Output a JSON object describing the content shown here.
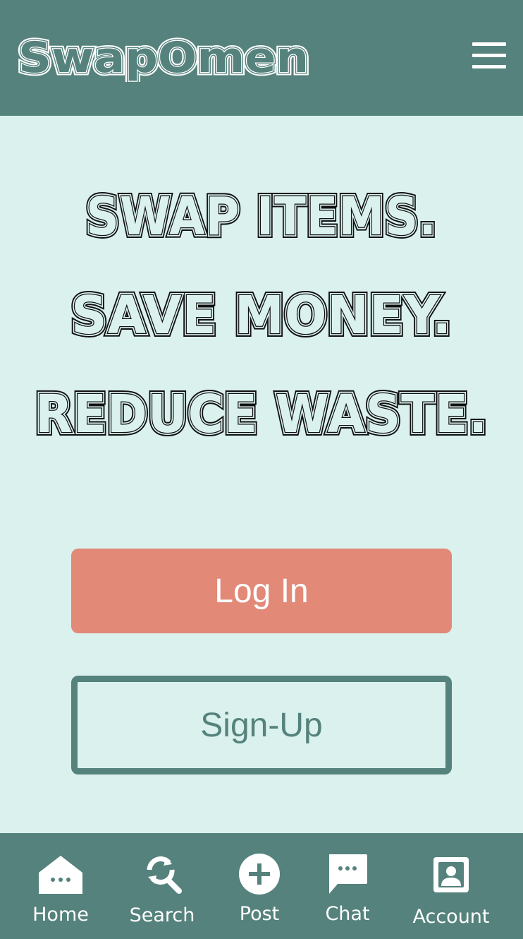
{
  "header": {
    "brand": "SwapOmen",
    "menu_icon": "hamburger-menu-icon"
  },
  "hero": {
    "lines": [
      "SWAP ITEMS.",
      "SAVE MONEY.",
      "REDUCE WASTE."
    ]
  },
  "actions": {
    "login_label": "Log In",
    "signup_label": "Sign-Up"
  },
  "bottom_nav": {
    "items": [
      {
        "label": "Home",
        "icon": "home-icon"
      },
      {
        "label": "Search",
        "icon": "search-icon"
      },
      {
        "label": "Post",
        "icon": "plus-circle-icon"
      },
      {
        "label": "Chat",
        "icon": "chat-bubble-icon"
      },
      {
        "label": "Account",
        "icon": "account-icon"
      }
    ]
  },
  "colors": {
    "header_bg": "#55827c",
    "page_bg": "#daf1ee",
    "login_bg": "#e28978",
    "signup_border": "#55827c",
    "text_dark": "#111111",
    "text_light": "#ffffff"
  }
}
